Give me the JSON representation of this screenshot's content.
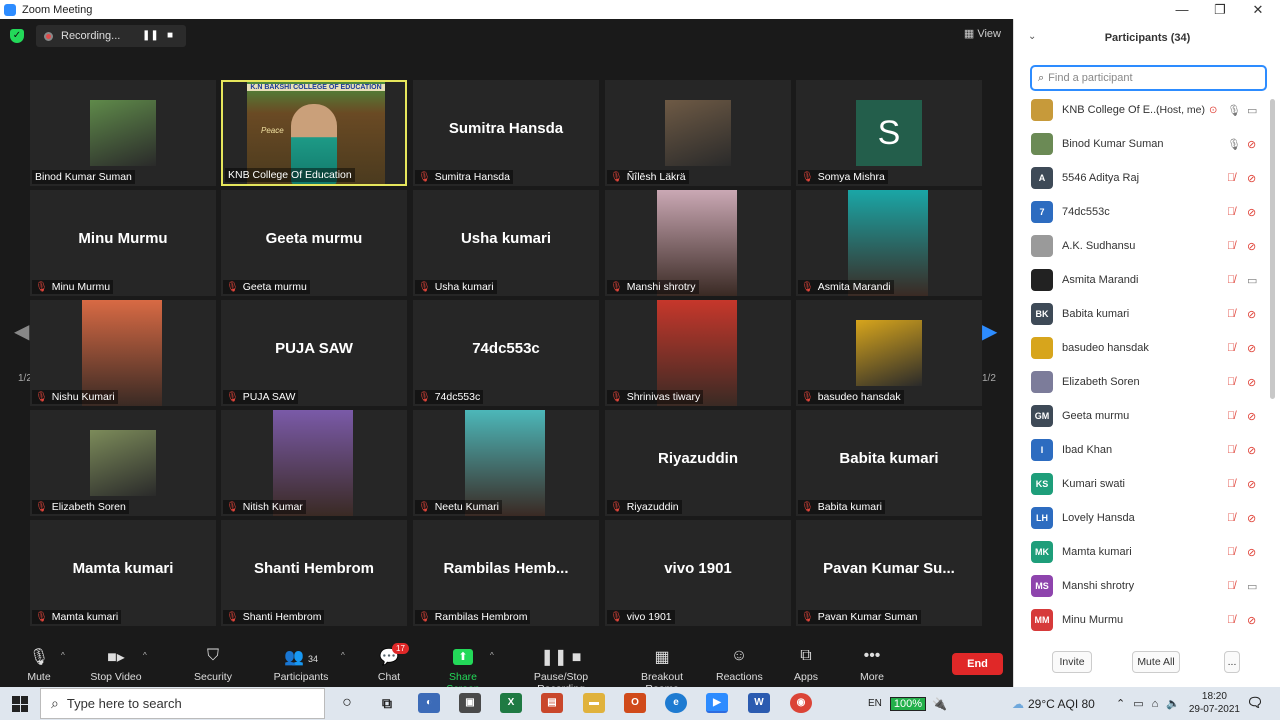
{
  "window": {
    "title": "Zoom Meeting",
    "minimize": "—",
    "maximize": "❐",
    "close": "✕"
  },
  "topbar": {
    "recording_label": "Recording...",
    "pause_glyph": "❚❚",
    "stop_glyph": "■",
    "view_label": "View"
  },
  "tiles": [
    {
      "name": "Binod Kumar Suman",
      "label": "Binod Kumar Suman",
      "muted": false,
      "kind": "photo",
      "photo_color": "#5f8a4a"
    },
    {
      "name": "KNB College Of Education",
      "label": "KNB College Of Education",
      "muted": false,
      "kind": "video",
      "active": true,
      "video_caption": "K.N BAKSHI COLLEGE OF EDUCATION",
      "video_sub": "Peace"
    },
    {
      "name": "Sumitra Hansda",
      "label": "Sumitra Hansda",
      "muted": true,
      "kind": "name"
    },
    {
      "name": "Ñîlēsh Läkrä",
      "label": "Ñîlēsh Läkrä",
      "muted": true,
      "kind": "photo",
      "photo_color": "#6e5a45"
    },
    {
      "name": "Somya Mishra",
      "label": "Somya Mishra",
      "muted": true,
      "kind": "letter",
      "letter": "S"
    },
    {
      "name": "Minu Murmu",
      "label": "Minu Murmu",
      "muted": true,
      "kind": "name"
    },
    {
      "name": "Geeta murmu",
      "label": "Geeta murmu",
      "muted": true,
      "kind": "name"
    },
    {
      "name": "Usha kumari",
      "label": "Usha kumari",
      "muted": true,
      "kind": "name"
    },
    {
      "name": "Manshi shrotry",
      "label": "Manshi shrotry",
      "muted": true,
      "kind": "video",
      "photo_color": "#caa8b4"
    },
    {
      "name": "Asmita Marandi",
      "label": "Asmita Marandi",
      "muted": true,
      "kind": "video",
      "photo_color": "#1aa6a6"
    },
    {
      "name": "Nishu Kumari",
      "label": "Nishu Kumari",
      "muted": true,
      "kind": "video",
      "photo_color": "#d86a44"
    },
    {
      "name": "PUJA SAW",
      "label": "PUJA SAW",
      "muted": true,
      "kind": "name"
    },
    {
      "name": "74dc553c",
      "label": "74dc553c",
      "muted": true,
      "kind": "name"
    },
    {
      "name": "Shrinivas tiwary",
      "label": "Shrinivas tiwary",
      "muted": true,
      "kind": "video",
      "photo_color": "#c6372b"
    },
    {
      "name": "basudeo hansdak",
      "label": "basudeo hansdak",
      "muted": true,
      "kind": "photo",
      "photo_color": "#d7a51c"
    },
    {
      "name": "Elizabeth Soren",
      "label": "Elizabeth Soren",
      "muted": true,
      "kind": "photo",
      "photo_color": "#7c8b5a"
    },
    {
      "name": "Nitish Kumar",
      "label": "Nitish Kumar",
      "muted": true,
      "kind": "video",
      "photo_color": "#7a5aa8"
    },
    {
      "name": "Neetu Kumari",
      "label": "Neetu Kumari",
      "muted": true,
      "kind": "video",
      "photo_color": "#4cb7b9"
    },
    {
      "name": "Riyazuddin",
      "label": "Riyazuddin",
      "muted": true,
      "kind": "name"
    },
    {
      "name": "Babita kumari",
      "label": "Babita kumari",
      "muted": true,
      "kind": "name"
    },
    {
      "name": "Mamta kumari",
      "label": "Mamta kumari",
      "muted": true,
      "kind": "name"
    },
    {
      "name": "Shanti Hembrom",
      "label": "Shanti Hembrom",
      "muted": true,
      "kind": "name"
    },
    {
      "name": "Rambilas Hemb...",
      "label": "Rambilas Hembrom",
      "muted": true,
      "kind": "name"
    },
    {
      "name": "vivo 1901",
      "label": "vivo 1901",
      "muted": true,
      "kind": "name"
    },
    {
      "name": "Pavan Kumar Su...",
      "label": "Pavan Kumar Suman",
      "muted": true,
      "kind": "name"
    }
  ],
  "pager": {
    "page": "1/2",
    "prev_glyph": "◀",
    "next_glyph": "▶"
  },
  "toolbar": {
    "mute": "Mute",
    "stop_video": "Stop Video",
    "security": "Security",
    "participants": "Participants",
    "participants_count": "34",
    "chat": "Chat",
    "chat_badge": "17",
    "share_screen": "Share Screen",
    "record": "Pause/Stop Recording",
    "breakout": "Breakout Rooms",
    "reactions": "Reactions",
    "apps": "Apps",
    "more": "More",
    "end": "End",
    "caret": "^"
  },
  "panel": {
    "title": "Participants (34)",
    "search_placeholder": "Find a participant",
    "invite": "Invite",
    "mute_all": "Mute All",
    "more": "..."
  },
  "participants": [
    {
      "name": "KNB College Of E...",
      "tag": "(Host, me)",
      "avatar": "",
      "color": "#c79a3a",
      "mic": "on",
      "cam": "on"
    },
    {
      "name": "Binod Kumar Suman",
      "avatar": "",
      "color": "#6b8a55",
      "mic": "on",
      "cam": "off"
    },
    {
      "name": "5546 Aditya Raj",
      "avatar": "A",
      "color": "#3e4a57",
      "mic": "off",
      "cam": "off"
    },
    {
      "name": "74dc553c",
      "avatar": "7",
      "color": "#2d6cc0",
      "mic": "off",
      "cam": "off"
    },
    {
      "name": "A.K. Sudhansu",
      "avatar": "",
      "color": "#9a9a9a",
      "mic": "off",
      "cam": "off"
    },
    {
      "name": "Asmita Marandi",
      "avatar": "",
      "color": "#222222",
      "mic": "off",
      "cam": "on"
    },
    {
      "name": "Babita kumari",
      "avatar": "BK",
      "color": "#3e4a57",
      "mic": "off",
      "cam": "off"
    },
    {
      "name": "basudeo hansdak",
      "avatar": "",
      "color": "#d7a51c",
      "mic": "off",
      "cam": "off"
    },
    {
      "name": "Elizabeth Soren",
      "avatar": "",
      "color": "#7c7c9a",
      "mic": "off",
      "cam": "off"
    },
    {
      "name": "Geeta murmu",
      "avatar": "GM",
      "color": "#3e4a57",
      "mic": "off",
      "cam": "off"
    },
    {
      "name": "Ibad Khan",
      "avatar": "I",
      "color": "#2d6cc0",
      "mic": "off",
      "cam": "off"
    },
    {
      "name": "Kumari swati",
      "avatar": "KS",
      "color": "#1e9e7a",
      "mic": "off",
      "cam": "off"
    },
    {
      "name": "Lovely Hansda",
      "avatar": "LH",
      "color": "#2d6cc0",
      "mic": "off",
      "cam": "off"
    },
    {
      "name": "Mamta kumari",
      "avatar": "MK",
      "color": "#1e9e7a",
      "mic": "off",
      "cam": "off"
    },
    {
      "name": "Manshi shrotry",
      "avatar": "MS",
      "color": "#8e44ad",
      "mic": "off",
      "cam": "on"
    },
    {
      "name": "Minu Murmu",
      "avatar": "MM",
      "color": "#d63a3a",
      "mic": "off",
      "cam": "off"
    }
  ],
  "taskbar": {
    "search_placeholder": "Type here to search",
    "lang": "EN",
    "battery": "100%",
    "weather": "29°C AQI 80",
    "time": "18:20",
    "date": "29-07-2021"
  },
  "colors": {
    "accent": "#2d8cff",
    "end": "#e02828",
    "share": "#23d959",
    "active_speaker": "#e6e65c"
  }
}
